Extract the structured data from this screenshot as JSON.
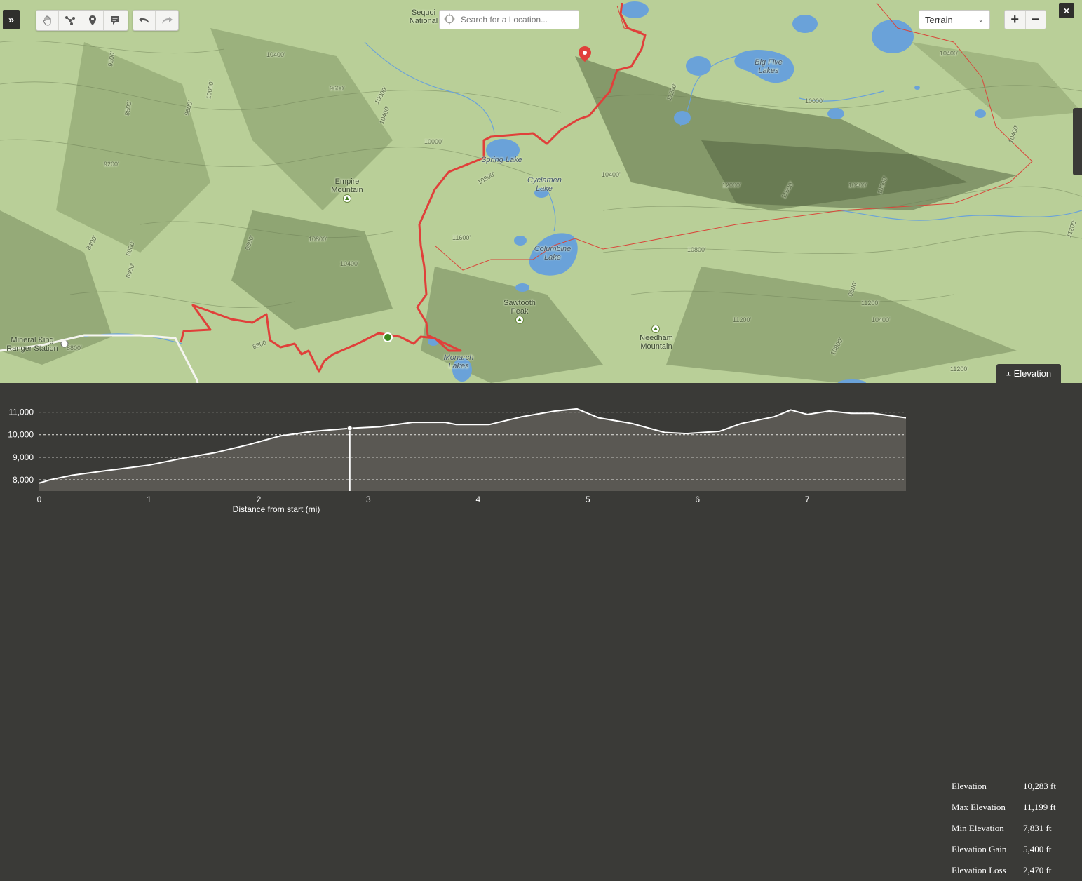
{
  "toolbar": {
    "expand_icon": "double-chevron-right-icon",
    "tools": [
      "hand-pan-icon",
      "route-draw-icon",
      "marker-pin-icon",
      "comment-icon"
    ],
    "history": [
      "undo-icon",
      "redo-icon"
    ]
  },
  "search": {
    "placeholder": "Search for a Location..."
  },
  "layer_select": {
    "value": "Terrain"
  },
  "zoom": {
    "in": "+",
    "out": "−"
  },
  "close": "×",
  "elevation_tab": {
    "label": "Elevation",
    "icon": "double-chevron-down-icon"
  },
  "map": {
    "labels": {
      "sequoia": "Sequoi National",
      "spring_lake": "Spring Lake",
      "cyclamen_lake": "Cyclamen Lake",
      "big_five_lakes": "Big Five Lakes",
      "empire_mountain": "Empire Mountain",
      "columbine_lake": "Columbine Lake",
      "sawtooth_peak": "Sawtooth Peak",
      "needham_mountain": "Needham Mountain",
      "monarch_lakes": "Monarch Lakes",
      "mineral_king": "Mineral King Ranger Station"
    },
    "contours": [
      "9200'",
      "8400'",
      "8800'",
      "9600'",
      "10000'",
      "9200'",
      "10400'",
      "9600'",
      "10000'",
      "10800'",
      "10400'",
      "10000'",
      "8800'",
      "8400'",
      "8000'",
      "8800'",
      "9600'",
      "10400'",
      "11600'",
      "11200'",
      "11600'",
      "10400'",
      "10800'",
      "11200'",
      "10000'",
      "10800'",
      "10400'",
      "11200'",
      "12000'",
      "11200'",
      "10400'",
      "9600'",
      "10000'",
      "11200'",
      "10400'",
      "10800'",
      "10400'"
    ],
    "colors": {
      "terrain": "#b9cf98",
      "route": "#e0403a",
      "boundary": "#d9463a",
      "water": "#6aa2d9"
    }
  },
  "stats": [
    {
      "label": "Elevation",
      "value": "10,283 ft"
    },
    {
      "label": "Max Elevation",
      "value": "11,199 ft"
    },
    {
      "label": "Min Elevation",
      "value": "7,831 ft"
    },
    {
      "label": "Elevation Gain",
      "value": "5,400 ft"
    },
    {
      "label": "Elevation Loss",
      "value": "2,470 ft"
    }
  ],
  "chart_data": {
    "type": "area",
    "xlabel": "Distance from start (mi)",
    "ylabel": "",
    "xlim": [
      0,
      7.9
    ],
    "ylim": [
      7500,
      11300
    ],
    "x_ticks": [
      0,
      1,
      2,
      3,
      4,
      5,
      6,
      7
    ],
    "y_ticks": [
      8000,
      9000,
      10000,
      11000
    ],
    "y_tick_labels": [
      "8,000",
      "9,000",
      "10,000",
      "11,000"
    ],
    "x": [
      0,
      0.1,
      0.3,
      0.6,
      1.0,
      1.3,
      1.6,
      1.9,
      2.2,
      2.5,
      2.83,
      3.1,
      3.4,
      3.7,
      3.8,
      4.1,
      4.4,
      4.7,
      4.9,
      5.1,
      5.4,
      5.7,
      5.9,
      6.2,
      6.4,
      6.7,
      6.85,
      7.0,
      7.2,
      7.4,
      7.6,
      7.9
    ],
    "y": [
      7850,
      8000,
      8200,
      8400,
      8650,
      8950,
      9200,
      9550,
      9950,
      10150,
      10283,
      10350,
      10550,
      10550,
      10450,
      10450,
      10800,
      11050,
      11150,
      10750,
      10500,
      10100,
      10050,
      10150,
      10500,
      10800,
      11100,
      10900,
      11050,
      10950,
      10950,
      10750
    ],
    "cursor": {
      "x": 2.83,
      "y": 10283
    }
  }
}
